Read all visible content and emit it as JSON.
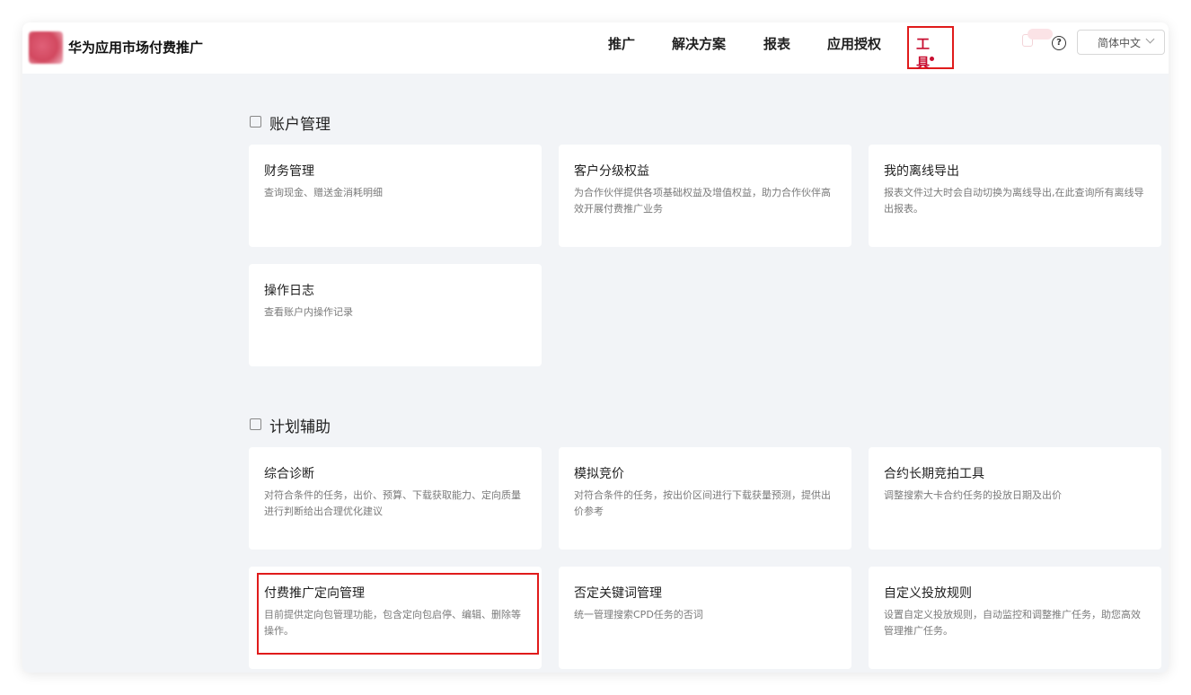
{
  "brand": {
    "title": "华为应用市场付费推广",
    "logo_icon": "app-logo-blurred"
  },
  "nav": {
    "items": [
      "推广",
      "解决方案",
      "报表",
      "应用授权",
      "工具"
    ],
    "active": "工具",
    "active_color": "#c80e30"
  },
  "header_right": {
    "help_icon": "question-circle-icon",
    "language": "简体中文"
  },
  "sections": [
    {
      "title": "账户管理",
      "icon": "user-icon",
      "cards": [
        {
          "title": "财务管理",
          "desc": "查询现金、赠送金消耗明细"
        },
        {
          "title": "客户分级权益",
          "desc": "为合作伙伴提供各项基础权益及增值权益，助力合作伙伴高效开展付费推广业务"
        },
        {
          "title": "我的离线导出",
          "desc": "报表文件过大时会自动切换为离线导出,在此查询所有离线导出报表。"
        },
        {
          "title": "操作日志",
          "desc": "查看账户内操作记录"
        }
      ]
    },
    {
      "title": "计划辅助",
      "icon": "plan-assist-icon",
      "cards": [
        {
          "title": "综合诊断",
          "desc": "对符合条件的任务，出价、预算、下载获取能力、定向质量进行判断给出合理优化建议"
        },
        {
          "title": "模拟竞价",
          "desc": "对符合条件的任务，按出价区间进行下载获量预测，提供出价参考"
        },
        {
          "title": "合约长期竞拍工具",
          "desc": "调整搜索大卡合约任务的投放日期及出价"
        },
        {
          "title": "付费推广定向管理",
          "desc": "目前提供定向包管理功能，包含定向包启停、编辑、删除等操作。"
        },
        {
          "title": "否定关键词管理",
          "desc": "统一管理搜索CPD任务的否词"
        },
        {
          "title": "自定义投放规则",
          "desc": "设置自定义投放规则，自动监控和调整推广任务，助您高效管理推广任务。"
        }
      ]
    }
  ],
  "highlight_color": "#e01b1b"
}
